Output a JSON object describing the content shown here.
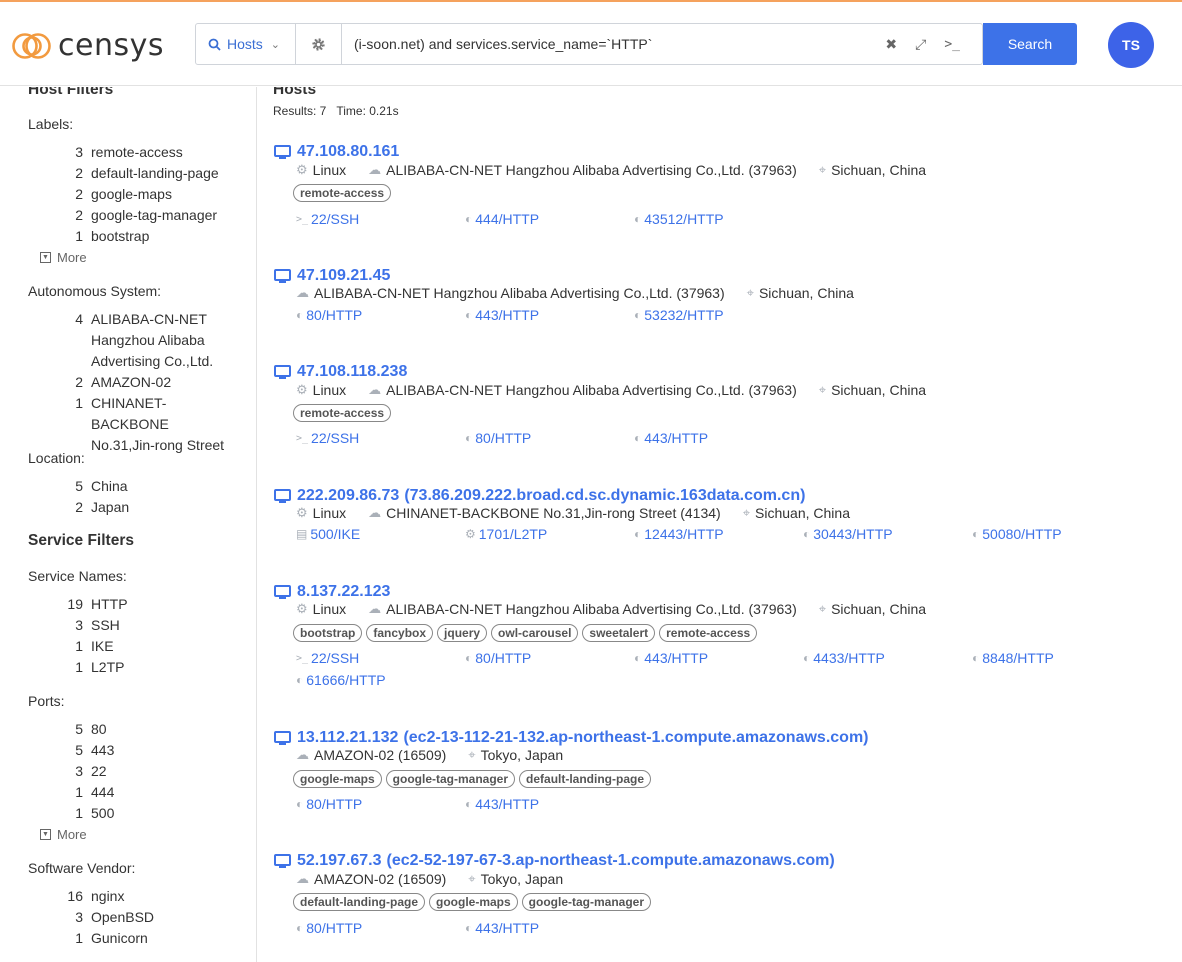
{
  "header": {
    "logo_text": "censys",
    "search_type": "Hosts",
    "query": "(i-soon.net) and services.service_name=`HTTP`",
    "search_label": "Search",
    "avatar_initials": "TS",
    "accent_color": "#3d72e8"
  },
  "sidebar": {
    "host_filters_title": "Host Filters",
    "service_filters_title": "Service Filters",
    "more_label": "More",
    "labels": {
      "title": "Labels:",
      "items": [
        {
          "count": "3",
          "label": "remote-access"
        },
        {
          "count": "2",
          "label": "default-landing-page"
        },
        {
          "count": "2",
          "label": "google-maps"
        },
        {
          "count": "2",
          "label": "google-tag-manager"
        },
        {
          "count": "1",
          "label": "bootstrap"
        }
      ]
    },
    "asn": {
      "title": "Autonomous System:",
      "items": [
        {
          "count": "4",
          "line1": "ALIBABA-CN-NET",
          "line2": "Hangzhou Alibaba",
          "line3": "Advertising Co.,Ltd."
        },
        {
          "count": "2",
          "line1": "AMAZON-02"
        },
        {
          "count": "1",
          "line1": "CHINANET-BACKBONE",
          "line2": "No.31,Jin-rong Street"
        }
      ]
    },
    "location": {
      "title": "Location:",
      "items": [
        {
          "count": "5",
          "label": "China"
        },
        {
          "count": "2",
          "label": "Japan"
        }
      ]
    },
    "service_names": {
      "title": "Service Names:",
      "items": [
        {
          "count": "19",
          "label": "HTTP"
        },
        {
          "count": "3",
          "label": "SSH"
        },
        {
          "count": "1",
          "label": "IKE"
        },
        {
          "count": "1",
          "label": "L2TP"
        }
      ]
    },
    "ports": {
      "title": "Ports:",
      "items": [
        {
          "count": "5",
          "label": "80"
        },
        {
          "count": "5",
          "label": "443"
        },
        {
          "count": "3",
          "label": "22"
        },
        {
          "count": "1",
          "label": "444"
        },
        {
          "count": "1",
          "label": "500"
        }
      ]
    },
    "software_vendor": {
      "title": "Software Vendor:",
      "items": [
        {
          "count": "16",
          "label": "nginx"
        },
        {
          "count": "3",
          "label": "OpenBSD"
        },
        {
          "count": "1",
          "label": "Gunicorn"
        }
      ]
    }
  },
  "results": {
    "title": "Hosts",
    "count_text": "Results: 7",
    "time_text": "Time: 0.21s",
    "hosts": [
      {
        "ip": "47.108.80.161",
        "dns": "",
        "os": "Linux",
        "asn": "ALIBABA-CN-NET Hangzhou Alibaba Advertising Co.,Ltd. (37963)",
        "location": "Sichuan, China",
        "tags": [
          "remote-access"
        ],
        "services": [
          {
            "icon": "terminal-icon",
            "label": "22/SSH"
          },
          {
            "icon": "globe-icon",
            "label": "444/HTTP"
          },
          {
            "icon": "globe-icon",
            "label": "43512/HTTP"
          }
        ]
      },
      {
        "ip": "47.109.21.45",
        "dns": "",
        "os": "",
        "asn": "ALIBABA-CN-NET Hangzhou Alibaba Advertising Co.,Ltd. (37963)",
        "location": "Sichuan, China",
        "tags": [],
        "services": [
          {
            "icon": "globe-icon",
            "label": "80/HTTP"
          },
          {
            "icon": "globe-icon",
            "label": "443/HTTP"
          },
          {
            "icon": "globe-icon",
            "label": "53232/HTTP"
          }
        ]
      },
      {
        "ip": "47.108.118.238",
        "dns": "",
        "os": "Linux",
        "asn": "ALIBABA-CN-NET Hangzhou Alibaba Advertising Co.,Ltd. (37963)",
        "location": "Sichuan, China",
        "tags": [
          "remote-access"
        ],
        "services": [
          {
            "icon": "terminal-icon",
            "label": "22/SSH"
          },
          {
            "icon": "globe-icon",
            "label": "80/HTTP"
          },
          {
            "icon": "globe-icon",
            "label": "443/HTTP"
          }
        ]
      },
      {
        "ip": "222.209.86.73",
        "dns": "(73.86.209.222.broad.cd.sc.dynamic.163data.com.cn)",
        "os": "Linux",
        "asn": "CHINANET-BACKBONE No.31,Jin-rong Street (4134)",
        "location": "Sichuan, China",
        "tags": [],
        "services": [
          {
            "icon": "id-card-icon",
            "label": "500/IKE"
          },
          {
            "icon": "gear-icon",
            "label": "1701/L2TP"
          },
          {
            "icon": "globe-icon",
            "label": "12443/HTTP"
          },
          {
            "icon": "globe-icon",
            "label": "30443/HTTP"
          },
          {
            "icon": "globe-icon",
            "label": "50080/HTTP"
          }
        ]
      },
      {
        "ip": "8.137.22.123",
        "dns": "",
        "os": "Linux",
        "asn": "ALIBABA-CN-NET Hangzhou Alibaba Advertising Co.,Ltd. (37963)",
        "location": "Sichuan, China",
        "tags": [
          "bootstrap",
          "fancybox",
          "jquery",
          "owl-carousel",
          "sweetalert",
          "remote-access"
        ],
        "services": [
          {
            "icon": "terminal-icon",
            "label": "22/SSH"
          },
          {
            "icon": "globe-icon",
            "label": "80/HTTP"
          },
          {
            "icon": "globe-icon",
            "label": "443/HTTP"
          },
          {
            "icon": "globe-icon",
            "label": "4433/HTTP"
          },
          {
            "icon": "globe-icon",
            "label": "8848/HTTP"
          },
          {
            "icon": "globe-icon",
            "label": "61666/HTTP"
          }
        ]
      },
      {
        "ip": "13.112.21.132",
        "dns": "(ec2-13-112-21-132.ap-northeast-1.compute.amazonaws.com)",
        "os": "",
        "asn": "AMAZON-02 (16509)",
        "location": "Tokyo, Japan",
        "tags": [
          "google-maps",
          "google-tag-manager",
          "default-landing-page"
        ],
        "services": [
          {
            "icon": "globe-icon",
            "label": "80/HTTP"
          },
          {
            "icon": "globe-icon",
            "label": "443/HTTP"
          }
        ]
      },
      {
        "ip": "52.197.67.3",
        "dns": "(ec2-52-197-67-3.ap-northeast-1.compute.amazonaws.com)",
        "os": "",
        "asn": "AMAZON-02 (16509)",
        "location": "Tokyo, Japan",
        "tags": [
          "default-landing-page",
          "google-maps",
          "google-tag-manager"
        ],
        "services": [
          {
            "icon": "globe-icon",
            "label": "80/HTTP"
          },
          {
            "icon": "globe-icon",
            "label": "443/HTTP"
          }
        ]
      }
    ]
  }
}
